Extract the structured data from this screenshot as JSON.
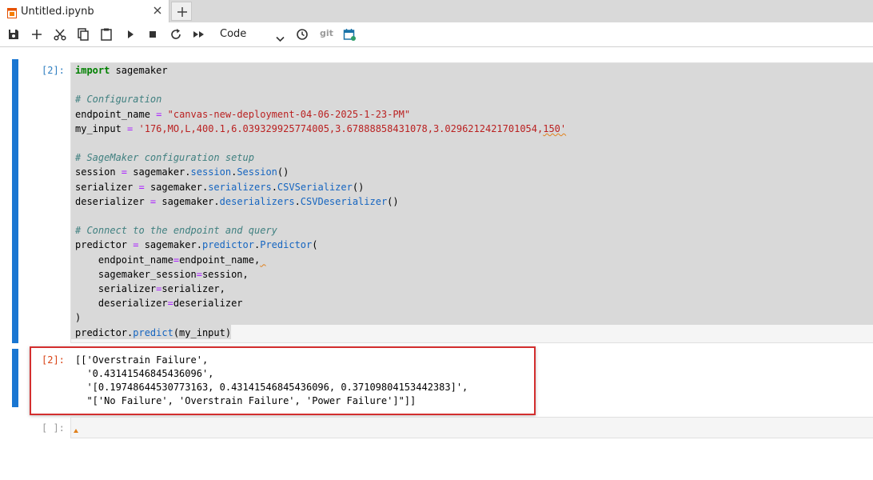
{
  "tab": {
    "title": "Untitled.ipynb"
  },
  "toolbar": {
    "cell_type": "Code",
    "git_label": "git"
  },
  "cells": {
    "code": {
      "prompt": "[2]:",
      "lines": {
        "l1": {
          "kw": "import",
          "rest": " sagemaker"
        },
        "l3": "# Configuration",
        "l4": {
          "a": "endpoint_name ",
          "op": "=",
          "sp": " ",
          "str": "\"canvas-new-deployment-04-06-2025-1-23-PM\""
        },
        "l5": {
          "a": "my_input ",
          "op": "=",
          "sp": " ",
          "str": "'176,MO,L,400.1,6.039329925774005,3.67888858431078,3.0296212421701054,",
          "str_sq": "150'"
        },
        "l7": "# SageMaker configuration setup",
        "l8": {
          "a": "session ",
          "op": "=",
          "b": " sagemaker.",
          "attr1": "session",
          "c": ".",
          "attr2": "Session",
          "d": "()"
        },
        "l9": {
          "a": "serializer ",
          "op": "=",
          "b": " sagemaker.",
          "attr1": "serializers",
          "c": ".",
          "attr2": "CSVSerializer",
          "d": "()"
        },
        "l10": {
          "a": "deserializer ",
          "op": "=",
          "b": " sagemaker.",
          "attr1": "deserializers",
          "c": ".",
          "attr2": "CSVDeserializer",
          "d": "()"
        },
        "l12": "# Connect to the endpoint and query",
        "l13": {
          "a": "predictor ",
          "op": "=",
          "b": " sagemaker.",
          "attr1": "predictor",
          "c": ".",
          "attr2": "Predictor",
          "d": "("
        },
        "l14": {
          "a": "    endpoint_name",
          "op": "=",
          "b": "endpoint_name,",
          "sq": " "
        },
        "l15": {
          "a": "    sagemaker_session",
          "op": "=",
          "b": "session,"
        },
        "l16": {
          "a": "    serializer",
          "op": "=",
          "b": "serializer,"
        },
        "l17": {
          "a": "    deserializer",
          "op": "=",
          "b": "deserializer"
        },
        "l18": ")",
        "l19": {
          "a": "predictor.",
          "attr1": "predict",
          "b": "(my_input)"
        }
      }
    },
    "output": {
      "prompt": "[2]:",
      "lines": [
        "[['Overstrain Failure',",
        "  '0.43141546845436096',",
        "  '[0.19748644530773163, 0.43141546845436096, 0.37109804153442383]',",
        "  \"['No Failure', 'Overstrain Failure', 'Power Failure']\"]]"
      ]
    },
    "empty": {
      "prompt": "[ ]:"
    }
  },
  "colors": {
    "accent": "#1976d2",
    "highlight_border": "#d32f2f",
    "input_prompt": "#307fc1",
    "output_prompt": "#d84315"
  },
  "icons": [
    "notebook-icon",
    "close-icon",
    "plus-icon",
    "save-icon",
    "scissors-icon",
    "copy-icon",
    "paste-icon",
    "run-icon",
    "stop-icon",
    "restart-icon",
    "fast-forward-icon",
    "chevron-down-icon",
    "clock-icon",
    "calendar-icon"
  ]
}
